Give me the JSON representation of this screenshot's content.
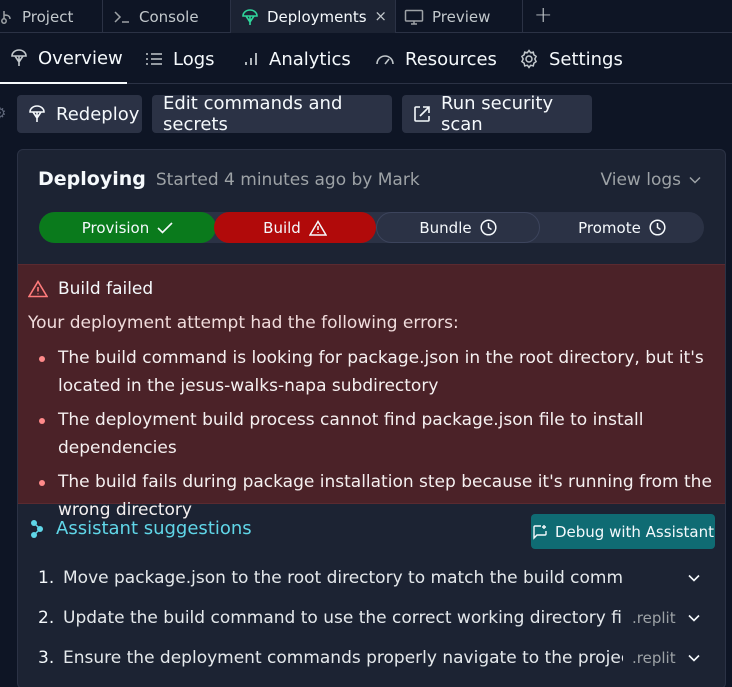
{
  "tabs": [
    {
      "label": "Project",
      "icon": "branch-icon"
    },
    {
      "label": "Console",
      "icon": "terminal-icon"
    },
    {
      "label": "Deployments",
      "icon": "deploy-icon",
      "active": true
    },
    {
      "label": "Preview",
      "icon": "monitor-icon"
    }
  ],
  "tab_close": "×",
  "tab_add": "+",
  "subnav": [
    {
      "label": "Overview",
      "icon": "deploy-icon",
      "active": true
    },
    {
      "label": "Logs",
      "icon": "list-icon"
    },
    {
      "label": "Analytics",
      "icon": "bar-chart-icon"
    },
    {
      "label": "Resources",
      "icon": "gauge-icon"
    },
    {
      "label": "Settings",
      "icon": "gear-icon"
    }
  ],
  "actions": {
    "redeploy": "Redeploy",
    "edit": "Edit commands and secrets",
    "scan": "Run security scan"
  },
  "deploy": {
    "title": "Deploying",
    "subtitle": "Started 4 minutes ago by Mark",
    "view_logs": "View logs"
  },
  "steps": [
    {
      "label": "Provision",
      "status": "success"
    },
    {
      "label": "Build",
      "status": "failed"
    },
    {
      "label": "Bundle",
      "status": "pending"
    },
    {
      "label": "Promote",
      "status": "pending"
    }
  ],
  "error": {
    "title": "Build failed",
    "intro": "Your deployment attempt had the following errors:",
    "items": [
      "The build command is looking for package.json in the root directory, but it's located in the jesus-walks-napa subdirectory",
      "The deployment build process cannot find package.json file to install dependencies",
      "The build fails during package installation step because it's running from the wrong directory"
    ]
  },
  "assistant": {
    "title": "Assistant suggestions",
    "debug_button": "Debug with Assistant",
    "suggestions": [
      {
        "num": "1.",
        "text": "Move package.json to the root directory to match the build command...",
        "source": ""
      },
      {
        "num": "2.",
        "text": "Update the build command to use the correct working directory first",
        "source": ".replit"
      },
      {
        "num": "3.",
        "text": "Ensure the deployment commands properly navigate to the project...",
        "source": ".replit"
      }
    ]
  },
  "colors": {
    "background": "#0e1525",
    "surface": "#1c2333",
    "success": "#0a7a1c",
    "failed": "#b10a0a",
    "error_bg": "#4b2228",
    "assistant_accent": "#60d6e8",
    "debug_button": "#0f6b73"
  }
}
